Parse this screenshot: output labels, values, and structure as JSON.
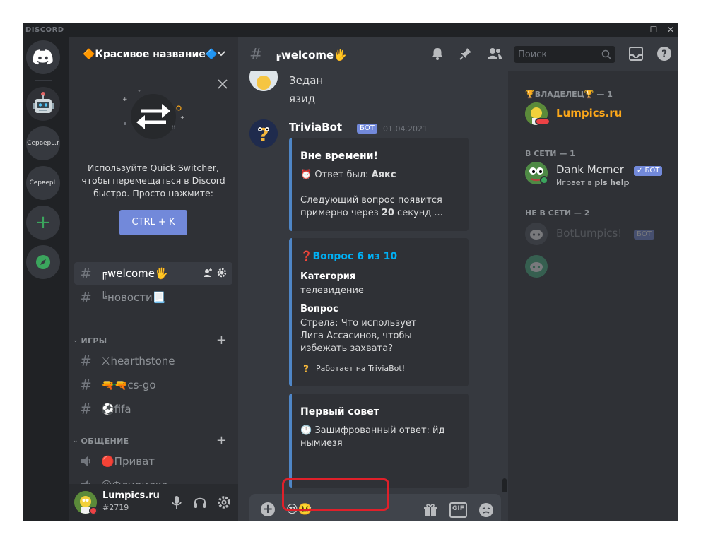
{
  "window": {
    "brand": "DISCORD"
  },
  "servers": {
    "items": [
      {
        "label": "СервеpL.r"
      },
      {
        "label": "СервеpL"
      }
    ]
  },
  "guild": {
    "name": "🔶Красивое название🔷"
  },
  "quick_switcher": {
    "text": "Используйте Quick Switcher, чтобы перемещаться в Discord быстро. Просто нажмите:",
    "button": "CTRL + K"
  },
  "channels": {
    "top": [
      {
        "name": "╔welcome🖐",
        "active": true
      },
      {
        "name": "╚новости📃",
        "active": false
      }
    ],
    "categories": [
      {
        "label": "ИГРЫ",
        "items": [
          {
            "name": "⚔hearthstone"
          },
          {
            "name": "🔫🔫cs-go"
          },
          {
            "name": "⚽fifa"
          }
        ]
      },
      {
        "label": "ОБЩЕНИЕ",
        "items": [
          {
            "name": "🔴Приват"
          },
          {
            "name": "😜Флудилка"
          }
        ]
      }
    ]
  },
  "user": {
    "name": "Lumpics.ru",
    "tag": "#2719"
  },
  "chat": {
    "channel": "╔welcome🖐",
    "search_placeholder": "Поиск",
    "messages": {
      "prev_line1": "Зедан",
      "prev_line2": "язид",
      "author": "TriviaBot",
      "badge": "БОТ",
      "timestamp": "01.04.2021"
    },
    "embed1": {
      "title": "Вне времени!",
      "answer_prefix": "⏰ Ответ был: ",
      "answer": "Аякс",
      "next_a": "Следующий вопрос появится",
      "next_b": "примерно через ",
      "next_num": "20",
      "next_c": " секунд ..."
    },
    "embed2": {
      "title_emoji": "❓",
      "title": "Вопрос 6 из 10",
      "cat_label": "Категория",
      "cat_value": "телевидение",
      "q_label": "Вопрос",
      "q_text": "Стрела: Что использует Лига Ассасинов, чтобы избежать захвата?",
      "footer": "Работает на TriviaBot!"
    },
    "embed3": {
      "title": "Первый совет",
      "text": "🕘 Зашифрованный ответ: йд нымиезя"
    },
    "composer": {
      "content": "😒🤒"
    }
  },
  "members": {
    "owner_cat": "🏆ВЛАДЕЛЕЦ🏆 — 1",
    "online_cat": "В СЕТИ — 1",
    "offline_cat": "НЕ В СЕТИ — 2",
    "owner": {
      "name": "Lumpics.ru",
      "color": "#faa61a"
    },
    "online": {
      "name": "Dank Memer",
      "badge": "✓ БОТ",
      "sub_prefix": "Играет в ",
      "sub_game": "pls help"
    },
    "offline": {
      "name": "BotLumpics!",
      "badge": "БОТ"
    }
  },
  "colors": {
    "accent": "#7289da",
    "online": "#3ba55d",
    "dnd": "#ed4245",
    "highlight": "#e0202a"
  }
}
